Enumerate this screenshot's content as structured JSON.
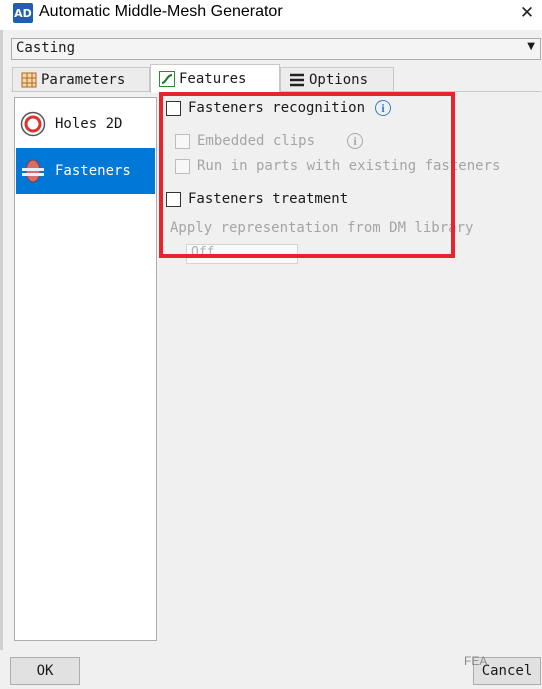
{
  "window": {
    "title": "Automatic Middle-Mesh Generator",
    "app_icon": "AD",
    "close_glyph": "✕"
  },
  "preset": {
    "value": "Casting",
    "arrow": "▼"
  },
  "tabs": [
    {
      "label": "Parameters",
      "icon": "grid-icon"
    },
    {
      "label": "Features",
      "icon": "curve-icon",
      "active": true
    },
    {
      "label": "Options",
      "icon": "list-icon"
    }
  ],
  "feature_list": [
    {
      "label": "Holes 2D",
      "icon": "ring-icon"
    },
    {
      "label": "Fasteners",
      "icon": "fastener-icon",
      "selected": true
    }
  ],
  "fasteners": {
    "recognition_label": "Fasteners recognition",
    "embedded_clips_label": "Embedded clips",
    "run_in_parts_label": "Run in parts with existing fasteners",
    "treatment_label": "Fasteners treatment",
    "apply_label": "Apply representation from DM library",
    "apply_value": "Off",
    "info_glyph": "i"
  },
  "buttons": {
    "ok": "OK",
    "cancel": "Cancel"
  },
  "watermark": "FEA",
  "colors": {
    "selection": "#0078d7",
    "highlight": "#e8232b",
    "info": "#2f7fd8"
  }
}
